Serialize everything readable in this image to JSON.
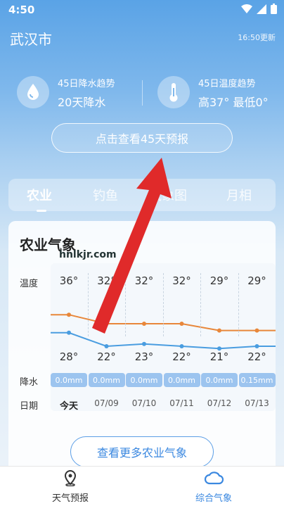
{
  "status_bar": {
    "time": "4:50"
  },
  "header": {
    "city": "武汉市",
    "updated": "16:50更新"
  },
  "trends": {
    "rain": {
      "title": "45日降水趋势",
      "value": "20天降水"
    },
    "temp": {
      "title": "45日温度趋势",
      "value": "高37° 最低0°"
    }
  },
  "forecast_button": "点击查看45天预报",
  "tabs": [
    "农业",
    "钓鱼",
    "气象图",
    "月相"
  ],
  "card": {
    "title": "农业气象",
    "row_labels": {
      "temp": "温度",
      "rain": "降水",
      "date": "日期"
    },
    "more_button": "查看更多农业气象"
  },
  "chart_data": {
    "type": "line",
    "x": [
      "今天",
      "07/09",
      "07/10",
      "07/11",
      "07/12",
      "07/13"
    ],
    "highs": [
      "36°",
      "32°",
      "32°",
      "32°",
      "29°",
      "29°"
    ],
    "lows": [
      "28°",
      "22°",
      "23°",
      "22°",
      "21°",
      "22°"
    ],
    "rain": [
      "0.0mm",
      "0.0mm",
      "0.0mm",
      "0.0mm",
      "0.0mm",
      "0.15mm"
    ],
    "series": [
      {
        "values": [
          36,
          32,
          32,
          32,
          29,
          29
        ],
        "color": "#e8873a"
      },
      {
        "values": [
          28,
          22,
          23,
          22,
          21,
          22
        ],
        "color": "#4a9de0"
      }
    ]
  },
  "watermark": "hnlkjr.com",
  "bottom_nav": {
    "weather": "天气预报",
    "climate": "综合气象"
  },
  "colors": {
    "accent": "#3b88e0",
    "arrow": "#e02a2a"
  }
}
